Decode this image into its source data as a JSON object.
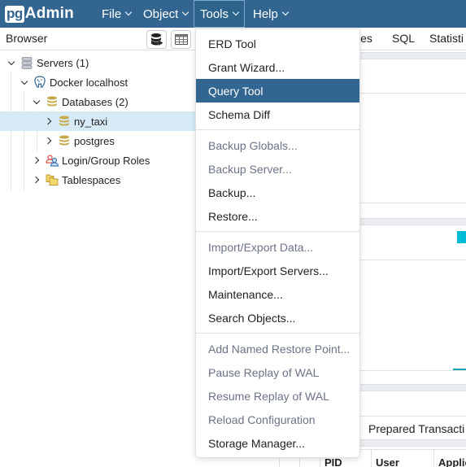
{
  "app": {
    "brand_prefix": "pg",
    "brand_suffix": "Admin"
  },
  "navbar": {
    "items": [
      {
        "label": "File",
        "active": false
      },
      {
        "label": "Object",
        "active": false
      },
      {
        "label": "Tools",
        "active": true
      },
      {
        "label": "Help",
        "active": false
      }
    ]
  },
  "browser": {
    "title": "Browser",
    "toolbar": {
      "query_tool_icon": "database-play-icon",
      "view_data_icon": "table-grid-icon"
    },
    "tree": [
      {
        "label": "Servers (1)",
        "icon": "servers-icon",
        "expanded": true,
        "level": 0
      },
      {
        "label": "Docker localhost",
        "icon": "postgres-elephant-icon",
        "expanded": true,
        "level": 1
      },
      {
        "label": "Databases (2)",
        "icon": "databases-icon",
        "expanded": true,
        "level": 2
      },
      {
        "label": "ny_taxi",
        "icon": "database-icon",
        "expanded": false,
        "level": 3,
        "selected": true
      },
      {
        "label": "postgres",
        "icon": "database-icon",
        "expanded": false,
        "level": 3
      },
      {
        "label": "Login/Group Roles",
        "icon": "roles-icon",
        "expanded": false,
        "level": 2
      },
      {
        "label": "Tablespaces",
        "icon": "tablespaces-icon",
        "expanded": false,
        "level": 2
      }
    ]
  },
  "main_tabs": {
    "visible": [
      "ies",
      "SQL",
      "Statisti"
    ]
  },
  "dashboard": {
    "prepared_tab": "Prepared Transacti",
    "grid_columns": [
      "PID",
      "User",
      "Applic"
    ]
  },
  "tools_menu": {
    "groups": [
      [
        {
          "label": "ERD Tool",
          "disabled": false
        },
        {
          "label": "Grant Wizard...",
          "disabled": false
        },
        {
          "label": "Query Tool",
          "disabled": false,
          "active": true
        },
        {
          "label": "Schema Diff",
          "disabled": false
        }
      ],
      [
        {
          "label": "Backup Globals...",
          "disabled": true
        },
        {
          "label": "Backup Server...",
          "disabled": true
        },
        {
          "label": "Backup...",
          "disabled": false
        },
        {
          "label": "Restore...",
          "disabled": false
        }
      ],
      [
        {
          "label": "Import/Export Data...",
          "disabled": true
        },
        {
          "label": "Import/Export Servers...",
          "disabled": false
        },
        {
          "label": "Maintenance...",
          "disabled": false
        },
        {
          "label": "Search Objects...",
          "disabled": false
        }
      ],
      [
        {
          "label": "Add Named Restore Point...",
          "disabled": true
        },
        {
          "label": "Pause Replay of WAL",
          "disabled": true
        },
        {
          "label": "Resume Replay of WAL",
          "disabled": true
        },
        {
          "label": "Reload Configuration",
          "disabled": true
        },
        {
          "label": "Storage Manager...",
          "disabled": false
        }
      ]
    ]
  },
  "colors": {
    "navbar": "#326690",
    "menu_active": "#326690",
    "tree_selected": "#d6ebf6",
    "disabled_text": "#6b7387",
    "accent_teal": "#00bcd4"
  }
}
